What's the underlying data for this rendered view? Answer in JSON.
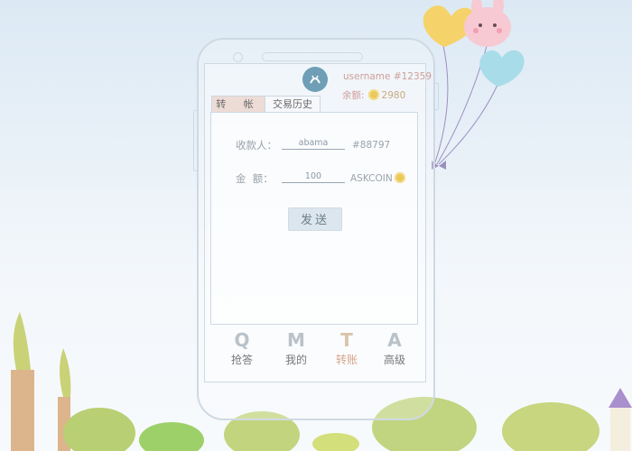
{
  "user": {
    "username": "username #12359",
    "balance_label": "余额:",
    "balance_value": "2980"
  },
  "tabs": [
    {
      "label": "转 帐"
    },
    {
      "label": "交易历史"
    }
  ],
  "form": {
    "recipient_label": "收款人：",
    "recipient_value": "abama",
    "recipient_id": "#88797",
    "amount_label": "金  额：",
    "amount_value": "100",
    "currency": "ASKCOIN"
  },
  "send_button": "发送",
  "bottom_nav": [
    {
      "letter": "Q",
      "label": "抢答"
    },
    {
      "letter": "M",
      "label": "我的"
    },
    {
      "letter": "T",
      "label": "转账"
    },
    {
      "letter": "A",
      "label": "高级"
    }
  ],
  "colors": {
    "accent_tab": "#eddcd6",
    "active_nav": "#d8a48a",
    "username": "#cf9e9a"
  }
}
